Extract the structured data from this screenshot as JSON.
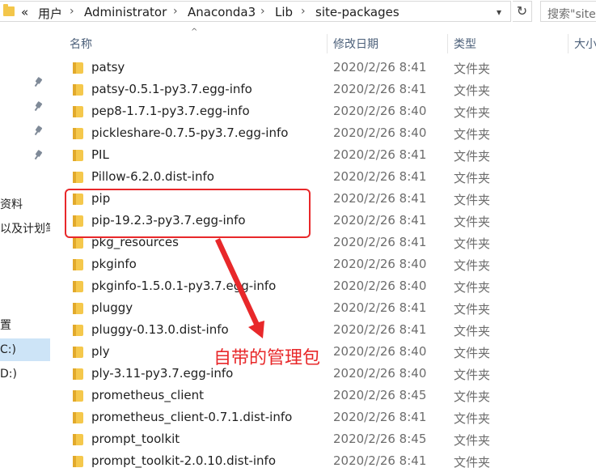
{
  "address_bar": {
    "overflow_chevron": "«",
    "breadcrumbs": [
      "用户",
      "Administrator",
      "Anaconda3",
      "Lib",
      "site-packages"
    ],
    "separator": "›",
    "dropdown_icon": "chevron-down",
    "refresh_icon": "refresh",
    "search_placeholder": "搜索\"site"
  },
  "nav_pane": {
    "items": [
      "资料",
      "以及计划笔",
      "置",
      "C:)",
      "D:)"
    ],
    "selected_item": "C:)"
  },
  "columns": [
    "名称",
    "修改日期",
    "类型",
    "大小"
  ],
  "sort_indicator": "^",
  "files": [
    {
      "name": "patsy",
      "date": "2020/2/26 8:41",
      "type": "文件夹"
    },
    {
      "name": "patsy-0.5.1-py3.7.egg-info",
      "date": "2020/2/26 8:41",
      "type": "文件夹"
    },
    {
      "name": "pep8-1.7.1-py3.7.egg-info",
      "date": "2020/2/26 8:40",
      "type": "文件夹"
    },
    {
      "name": "pickleshare-0.7.5-py3.7.egg-info",
      "date": "2020/2/26 8:40",
      "type": "文件夹"
    },
    {
      "name": "PIL",
      "date": "2020/2/26 8:41",
      "type": "文件夹"
    },
    {
      "name": "Pillow-6.2.0.dist-info",
      "date": "2020/2/26 8:41",
      "type": "文件夹"
    },
    {
      "name": "pip",
      "date": "2020/2/26 8:41",
      "type": "文件夹"
    },
    {
      "name": "pip-19.2.3-py3.7.egg-info",
      "date": "2020/2/26 8:41",
      "type": "文件夹"
    },
    {
      "name": "pkg_resources",
      "date": "2020/2/26 8:41",
      "type": "文件夹"
    },
    {
      "name": "pkginfo",
      "date": "2020/2/26 8:40",
      "type": "文件夹"
    },
    {
      "name": "pkginfo-1.5.0.1-py3.7.egg-info",
      "date": "2020/2/26 8:40",
      "type": "文件夹"
    },
    {
      "name": "pluggy",
      "date": "2020/2/26 8:41",
      "type": "文件夹"
    },
    {
      "name": "pluggy-0.13.0.dist-info",
      "date": "2020/2/26 8:41",
      "type": "文件夹"
    },
    {
      "name": "ply",
      "date": "2020/2/26 8:40",
      "type": "文件夹"
    },
    {
      "name": "ply-3.11-py3.7.egg-info",
      "date": "2020/2/26 8:40",
      "type": "文件夹"
    },
    {
      "name": "prometheus_client",
      "date": "2020/2/26 8:45",
      "type": "文件夹"
    },
    {
      "name": "prometheus_client-0.7.1.dist-info",
      "date": "2020/2/26 8:41",
      "type": "文件夹"
    },
    {
      "name": "prompt_toolkit",
      "date": "2020/2/26 8:45",
      "type": "文件夹"
    },
    {
      "name": "prompt_toolkit-2.0.10.dist-info",
      "date": "2020/2/26 8:41",
      "type": "文件夹"
    }
  ],
  "annotation": {
    "label": "自带的管理包",
    "color": "#e8282a"
  },
  "colors": {
    "folder": "#f5c84c",
    "header_text": "#4c607a",
    "selected_nav": "#cde4f7"
  }
}
